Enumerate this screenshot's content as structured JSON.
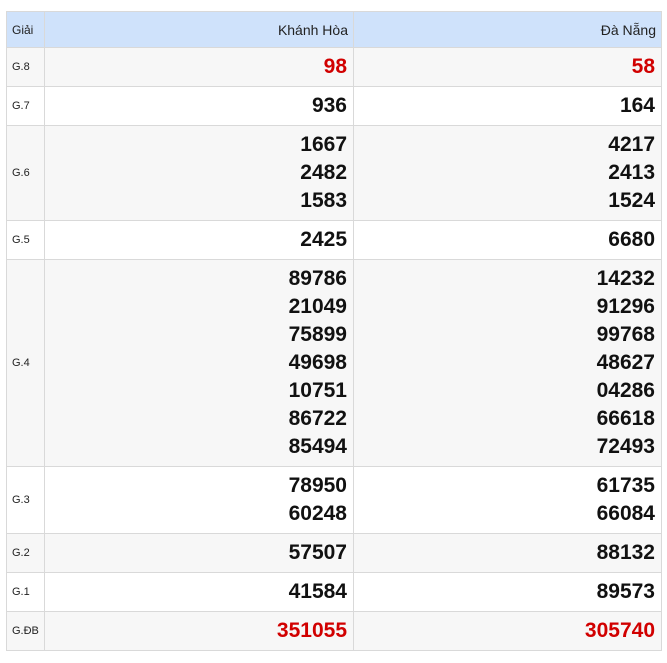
{
  "header": {
    "prize_label": "Giải",
    "provinces": [
      "Khánh Hòa",
      "Đà Nẵng"
    ]
  },
  "colors": {
    "header_bg": "#cfe2fb",
    "special_red": "#d10000"
  },
  "rows": [
    {
      "prize": "G.8",
      "special": true,
      "khanh_hoa": [
        "98"
      ],
      "da_nang": [
        "58"
      ]
    },
    {
      "prize": "G.7",
      "special": false,
      "khanh_hoa": [
        "936"
      ],
      "da_nang": [
        "164"
      ]
    },
    {
      "prize": "G.6",
      "special": false,
      "khanh_hoa": [
        "1667",
        "2482",
        "1583"
      ],
      "da_nang": [
        "4217",
        "2413",
        "1524"
      ]
    },
    {
      "prize": "G.5",
      "special": false,
      "khanh_hoa": [
        "2425"
      ],
      "da_nang": [
        "6680"
      ]
    },
    {
      "prize": "G.4",
      "special": false,
      "khanh_hoa": [
        "89786",
        "21049",
        "75899",
        "49698",
        "10751",
        "86722",
        "85494"
      ],
      "da_nang": [
        "14232",
        "91296",
        "99768",
        "48627",
        "04286",
        "66618",
        "72493"
      ]
    },
    {
      "prize": "G.3",
      "special": false,
      "khanh_hoa": [
        "78950",
        "60248"
      ],
      "da_nang": [
        "61735",
        "66084"
      ]
    },
    {
      "prize": "G.2",
      "special": false,
      "khanh_hoa": [
        "57507"
      ],
      "da_nang": [
        "88132"
      ]
    },
    {
      "prize": "G.1",
      "special": false,
      "khanh_hoa": [
        "41584"
      ],
      "da_nang": [
        "89573"
      ]
    },
    {
      "prize": "G.ĐB",
      "special": true,
      "khanh_hoa": [
        "351055"
      ],
      "da_nang": [
        "305740"
      ]
    }
  ]
}
